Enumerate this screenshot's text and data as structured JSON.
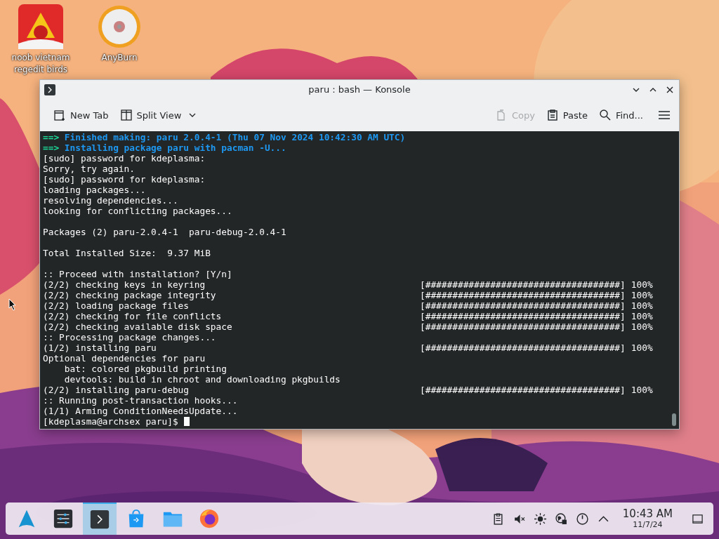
{
  "desktop_icons": [
    {
      "label": "noob vietnam regedit birds",
      "kind": "game"
    },
    {
      "label": "AnyBurn",
      "kind": "disc"
    }
  ],
  "window": {
    "title": "paru : bash — Konsole"
  },
  "toolbar": {
    "left": [
      {
        "label": "New Tab",
        "kind": "new-tab",
        "disabled": false
      },
      {
        "label": "Split View",
        "kind": "split",
        "disabled": false
      }
    ],
    "right": [
      {
        "label": "Copy",
        "kind": "copy",
        "disabled": true
      },
      {
        "label": "Paste",
        "kind": "paste",
        "disabled": false
      },
      {
        "label": "Find...",
        "kind": "find",
        "disabled": false
      }
    ]
  },
  "terminal": {
    "lines": [
      {
        "kind": "arrow",
        "marker": "==>",
        "text": "Finished making: paru 2.0.4-1 (Thu 07 Nov 2024 10:42:30 AM UTC)"
      },
      {
        "kind": "arrow",
        "marker": "==>",
        "text": "Installing package paru with pacman -U..."
      },
      {
        "kind": "text",
        "text": "[sudo] password for kdeplasma:"
      },
      {
        "kind": "text",
        "text": "Sorry, try again."
      },
      {
        "kind": "text",
        "text": "[sudo] password for kdeplasma:"
      },
      {
        "kind": "text",
        "text": "loading packages..."
      },
      {
        "kind": "text",
        "text": "resolving dependencies..."
      },
      {
        "kind": "text",
        "text": "looking for conflicting packages..."
      },
      {
        "kind": "blank"
      },
      {
        "kind": "text",
        "text": "Packages (2) paru-2.0.4-1  paru-debug-2.0.4-1"
      },
      {
        "kind": "blank"
      },
      {
        "kind": "text",
        "text": "Total Installed Size:  9.37 MiB"
      },
      {
        "kind": "blank"
      },
      {
        "kind": "text",
        "text": ":: Proceed with installation? [Y/n]"
      },
      {
        "kind": "progress",
        "text": "(2/2) checking keys in keyring",
        "bar": "[####################################]",
        "percent": "100%"
      },
      {
        "kind": "progress",
        "text": "(2/2) checking package integrity",
        "bar": "[####################################]",
        "percent": "100%"
      },
      {
        "kind": "progress",
        "text": "(2/2) loading package files",
        "bar": "[####################################]",
        "percent": "100%"
      },
      {
        "kind": "progress",
        "text": "(2/2) checking for file conflicts",
        "bar": "[####################################]",
        "percent": "100%"
      },
      {
        "kind": "progress",
        "text": "(2/2) checking available disk space",
        "bar": "[####################################]",
        "percent": "100%"
      },
      {
        "kind": "text",
        "text": ":: Processing package changes..."
      },
      {
        "kind": "progress",
        "text": "(1/2) installing paru",
        "bar": "[####################################]",
        "percent": "100%"
      },
      {
        "kind": "text",
        "text": "Optional dependencies for paru"
      },
      {
        "kind": "text",
        "text": "    bat: colored pkgbuild printing"
      },
      {
        "kind": "text",
        "text": "    devtools: build in chroot and downloading pkgbuilds"
      },
      {
        "kind": "progress",
        "text": "(2/2) installing paru-debug",
        "bar": "[####################################]",
        "percent": "100%"
      },
      {
        "kind": "text",
        "text": ":: Running post-transaction hooks..."
      },
      {
        "kind": "text",
        "text": "(1/1) Arming ConditionNeedsUpdate..."
      },
      {
        "kind": "prompt",
        "text": "[kdeplasma@archsex paru]$"
      }
    ]
  },
  "taskbar": {
    "apps": [
      {
        "kind": "launcher",
        "selected": false
      },
      {
        "kind": "settings",
        "selected": false
      },
      {
        "kind": "terminal",
        "selected": true
      },
      {
        "kind": "store",
        "selected": false
      },
      {
        "kind": "folder",
        "selected": false
      },
      {
        "kind": "browser",
        "selected": false
      }
    ],
    "tray": [
      {
        "kind": "clipboard"
      },
      {
        "kind": "volume-muted"
      },
      {
        "kind": "brightness"
      },
      {
        "kind": "network"
      },
      {
        "kind": "updates"
      },
      {
        "kind": "expand"
      }
    ],
    "time": "10:43 AM",
    "date": "11/7/24"
  }
}
